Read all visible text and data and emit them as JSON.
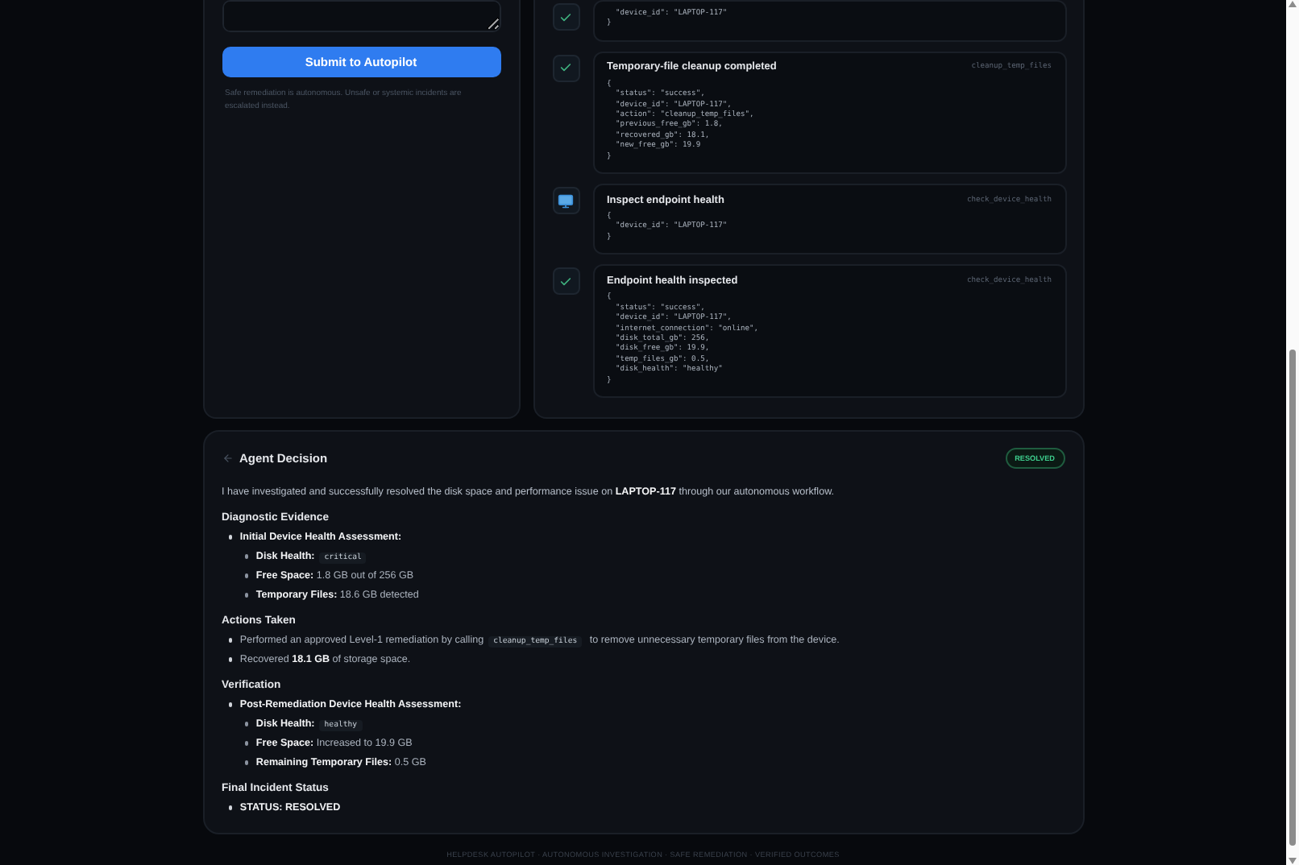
{
  "request_panel": {
    "submit_button": "Submit to Autopilot",
    "note": "Safe remediation is autonomous. Unsafe or systemic incidents are escalated instead."
  },
  "timeline": [
    {
      "kind": "result",
      "json": [
        "  \"device_id\": \"LAPTOP-117\"",
        "}"
      ]
    },
    {
      "kind": "result",
      "title": "Temporary-file cleanup completed",
      "tool": "cleanup_temp_files",
      "json": [
        "{",
        "  \"status\": \"success\",",
        "  \"device_id\": \"LAPTOP-117\",",
        "  \"action\": \"cleanup_temp_files\",",
        "  \"previous_free_gb\": 1.8,",
        "  \"recovered_gb\": 18.1,",
        "  \"new_free_gb\": 19.9",
        "}"
      ]
    },
    {
      "kind": "call",
      "title": "Inspect endpoint health",
      "tool": "check_device_health",
      "json": [
        "{",
        "  \"device_id\": \"LAPTOP-117\"",
        "}"
      ]
    },
    {
      "kind": "result",
      "title": "Endpoint health inspected",
      "tool": "check_device_health",
      "json": [
        "{",
        "  \"status\": \"success\",",
        "  \"device_id\": \"LAPTOP-117\",",
        "  \"internet_connection\": \"online\",",
        "  \"disk_total_gb\": 256,",
        "  \"disk_free_gb\": 19.9,",
        "  \"temp_files_gb\": 0.5,",
        "  \"disk_health\": \"healthy\"",
        "}"
      ]
    }
  ],
  "decision": {
    "title": "Agent Decision",
    "status": "RESOLVED",
    "summary": "I have investigated and successfully resolved the disk space and performance issue on **LAPTOP-117** through our autonomous workflow.",
    "sections": [
      {
        "heading": "Diagnostic Evidence",
        "items": [
          {
            "parts": [
              {
                "kind": "bold",
                "text": "Initial Device Health Assessment:"
              }
            ],
            "children": [
              {
                "parts": [
                  {
                    "kind": "bold",
                    "text": "Disk Health:"
                  },
                  {
                    "kind": "code",
                    "text": "critical"
                  }
                ]
              },
              {
                "parts": [
                  {
                    "kind": "bold",
                    "text": "Free Space:"
                  },
                  {
                    "kind": "text",
                    "text": "1.8 GB out of 256 GB"
                  }
                ]
              },
              {
                "parts": [
                  {
                    "kind": "bold",
                    "text": "Temporary Files:"
                  },
                  {
                    "kind": "text",
                    "text": "18.6 GB detected"
                  }
                ]
              }
            ]
          }
        ]
      },
      {
        "heading": "Actions Taken",
        "items": [
          {
            "parts": [
              {
                "kind": "text",
                "text": "Performed an approved Level-1 remediation by calling"
              },
              {
                "kind": "code",
                "text": "cleanup_temp_files"
              },
              {
                "kind": "text",
                "text": "to remove unnecessary temporary files from the device."
              }
            ]
          },
          {
            "parts": [
              {
                "kind": "text",
                "text": "Recovered **18.1 GB** of storage space."
              }
            ]
          }
        ]
      },
      {
        "heading": "Verification",
        "items": [
          {
            "parts": [
              {
                "kind": "bold",
                "text": "Post-Remediation Device Health Assessment:"
              }
            ],
            "children": [
              {
                "parts": [
                  {
                    "kind": "bold",
                    "text": "Disk Health:"
                  },
                  {
                    "kind": "code",
                    "text": "healthy"
                  }
                ]
              },
              {
                "parts": [
                  {
                    "kind": "bold",
                    "text": "Free Space:"
                  },
                  {
                    "kind": "text",
                    "text": "Increased to 19.9 GB"
                  }
                ]
              },
              {
                "parts": [
                  {
                    "kind": "bold",
                    "text": "Remaining Temporary Files:"
                  },
                  {
                    "kind": "text",
                    "text": "0.5 GB"
                  }
                ]
              }
            ]
          }
        ]
      },
      {
        "heading": "Final Incident Status",
        "items": [
          {
            "parts": [
              {
                "kind": "bold",
                "text": "STATUS: RESOLVED"
              }
            ]
          }
        ]
      }
    ]
  },
  "footer": "HELPDESK AUTOPILOT · AUTONOMOUS INVESTIGATION · SAFE REMEDIATION · VERIFIED OUTCOMES"
}
